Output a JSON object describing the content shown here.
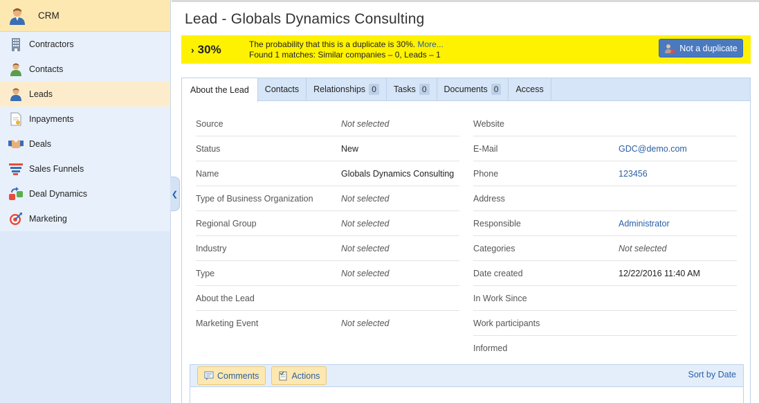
{
  "sidebar": {
    "crm_label": "CRM",
    "items": [
      {
        "label": "Contractors",
        "icon": "building-icon"
      },
      {
        "label": "Contacts",
        "icon": "person-icon"
      },
      {
        "label": "Leads",
        "icon": "lead-icon",
        "active": true
      },
      {
        "label": "Inpayments",
        "icon": "inpayments-icon"
      },
      {
        "label": "Deals",
        "icon": "handshake-icon"
      },
      {
        "label": "Sales Funnels",
        "icon": "funnel-icon"
      },
      {
        "label": "Deal Dynamics",
        "icon": "dynamics-icon"
      },
      {
        "label": "Marketing",
        "icon": "target-icon"
      }
    ]
  },
  "page": {
    "title": "Lead - Globals Dynamics Consulting"
  },
  "duplicate": {
    "percent": "30%",
    "line1": "The probability that this is a duplicate is 30%.",
    "more": "More...",
    "line2": "Found 1 matches: Similar companies – 0, Leads – 1",
    "button": "Not a duplicate"
  },
  "tabs": [
    {
      "label": "About the Lead"
    },
    {
      "label": "Contacts"
    },
    {
      "label": "Relationships",
      "count": "0"
    },
    {
      "label": "Tasks",
      "count": "0"
    },
    {
      "label": "Documents",
      "count": "0"
    },
    {
      "label": "Access"
    }
  ],
  "fields_left": [
    {
      "label": "Source",
      "value": "Not selected"
    },
    {
      "label": "Status",
      "value": "New"
    },
    {
      "label": "Name",
      "value": "Globals Dynamics Consulting"
    },
    {
      "label": "Type of Business Organization",
      "value": "Not selected"
    },
    {
      "label": "Regional Group",
      "value": "Not selected"
    },
    {
      "label": "Industry",
      "value": "Not selected"
    },
    {
      "label": "Type",
      "value": "Not selected"
    },
    {
      "label": "About the Lead",
      "value": ""
    },
    {
      "label": "Marketing Event",
      "value": "Not selected"
    }
  ],
  "fields_right": [
    {
      "label": "Website",
      "value": ""
    },
    {
      "label": "E-Mail",
      "value": "GDC@demo.com"
    },
    {
      "label": "Phone",
      "value": "123456"
    },
    {
      "label": "Address",
      "value": ""
    },
    {
      "label": "Responsible",
      "value": "Administrator"
    },
    {
      "label": "Categories",
      "value": "Not selected"
    },
    {
      "label": "Date created",
      "value": "12/22/2016 11:40 AM"
    },
    {
      "label": "In Work Since",
      "value": ""
    },
    {
      "label": "Work participants",
      "value": ""
    },
    {
      "label": "Informed",
      "value": ""
    }
  ],
  "comments": {
    "comments_button": "Comments",
    "actions_button": "Actions",
    "sort": "Sort by Date"
  },
  "colors": {
    "banner": "#fff200",
    "accent": "#4a79c0",
    "link": "#2a5fa5",
    "sidebar": "#e8f0fb"
  }
}
